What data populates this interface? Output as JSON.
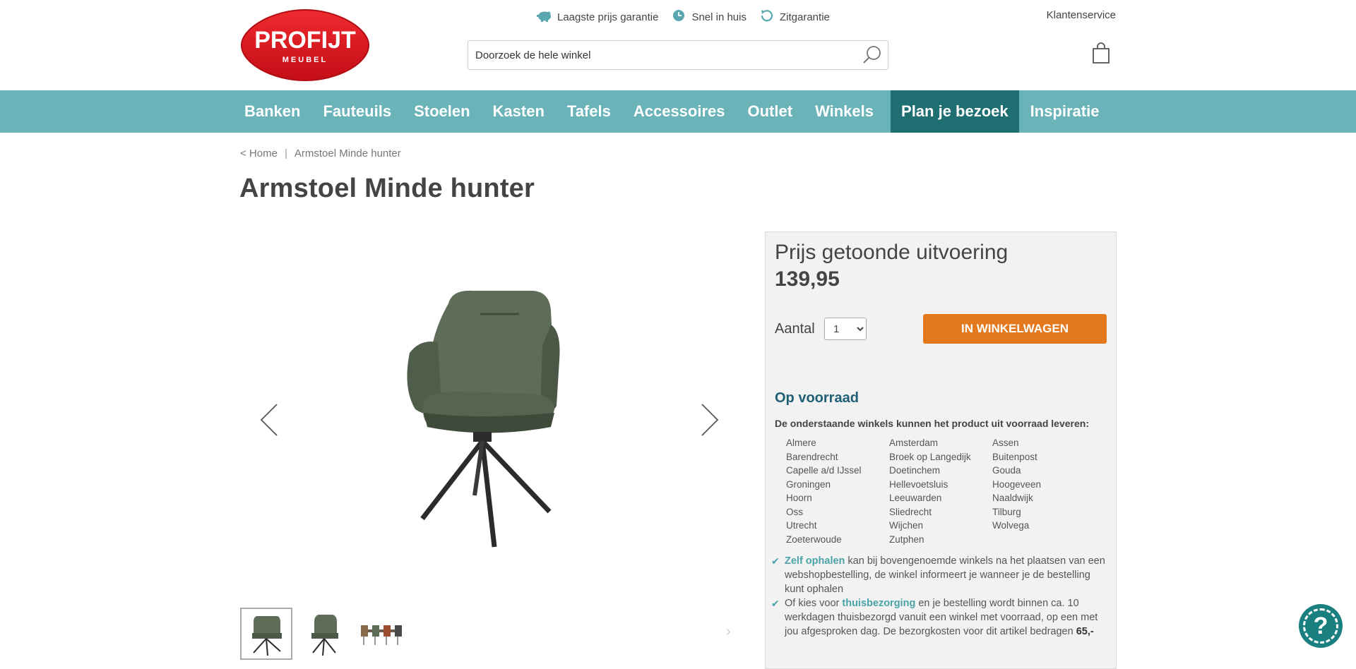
{
  "header": {
    "logo": {
      "brand": "PROFIJT",
      "sub": "MEUBEL"
    },
    "usps": [
      {
        "icon": "piggy-bank-icon",
        "label": "Laagste prijs garantie"
      },
      {
        "icon": "clock-icon",
        "label": "Snel in huis"
      },
      {
        "icon": "refresh-icon",
        "label": "Zitgarantie"
      }
    ],
    "service_link": "Klantenservice",
    "search": {
      "placeholder": "Doorzoek de hele winkel"
    }
  },
  "nav": {
    "items": [
      "Banken",
      "Fauteuils",
      "Stoelen",
      "Kasten",
      "Tafels",
      "Accessoires",
      "Outlet",
      "Winkels",
      "Plan je bezoek",
      "Inspiratie"
    ],
    "active": "Plan je bezoek"
  },
  "breadcrumb": {
    "home": "< Home",
    "separator": "|",
    "current": "Armstoel Minde hunter"
  },
  "product": {
    "title": "Armstoel Minde hunter",
    "price_label": "Prijs getoonde uitvoering",
    "price": "139,95",
    "qty_label": "Aantal",
    "qty_value": "1",
    "add_to_cart": "IN WINKELWAGEN",
    "stock_status": "Op voorraad",
    "stock_sub": "De onderstaande winkels kunnen het product uit voorraad leveren:",
    "stores": [
      "Almere",
      "Amsterdam",
      "Assen",
      "Barendrecht",
      "Broek op Langedijk",
      "Buitenpost",
      "Capelle a/d IJssel",
      "Doetinchem",
      "Gouda",
      "Groningen",
      "Hellevoetsluis",
      "Hoogeveen",
      "Hoorn",
      "Leeuwarden",
      "Naaldwijk",
      "Oss",
      "Sliedrecht",
      "Tilburg",
      "Utrecht",
      "Wijchen",
      "Wolvega",
      "Zoeterwoude",
      "Zutphen"
    ],
    "delivery": {
      "pickup_hl": "Zelf ophalen",
      "pickup_text": " kan bij bovengenoemde winkels na het plaatsen van een webshopbestelling, de winkel informeert je wanneer je de bestelling kunt ophalen",
      "home_pre": "Of kies voor ",
      "home_hl": "thuisbezorging",
      "home_text": " en je bestelling wordt binnen ca. 10 werkdagen thuisbezorgd vanuit een winkel met voorraad, op een met jou afgesproken dag. De bezorgkosten voor dit artikel bedragen ",
      "home_cost": "65,-"
    }
  },
  "colors": {
    "nav_bg": "#6ab3b9",
    "nav_active": "#1f6e72",
    "cta": "#e3781c",
    "accent": "#4aa3a9",
    "brand_red": "#d8151f"
  }
}
